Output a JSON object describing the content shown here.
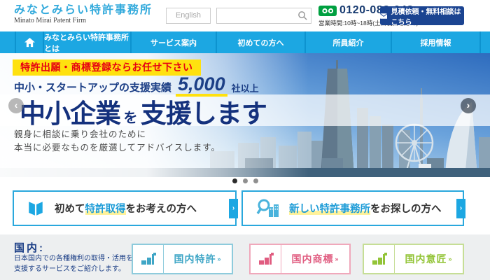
{
  "header": {
    "logo_title": "みなとみらい特許事務所",
    "logo_subtitle": "Minato Mirai Patent Firm",
    "english_button": "English",
    "search_value": "",
    "phone": "0120-088-048",
    "hours": "営業時間:10時~18時(土日祝日を除く)",
    "cta_label": "見積依頼・無料相談はこちら"
  },
  "nav": {
    "items": [
      {
        "label": "みなとみらい特許事務所とは"
      },
      {
        "label": "サービス案内"
      },
      {
        "label": "初めての方へ"
      },
      {
        "label": "所員紹介"
      },
      {
        "label": "採用情報"
      }
    ]
  },
  "hero": {
    "ribbon": "特許出願・商標登録ならお任せ下さい",
    "stat_prefix": "中小・スタートアップの支援実績",
    "stat_number": "5,000",
    "stat_suffix": "社以上",
    "title_part1": "中小企業",
    "title_particle": "を",
    "title_part2": "支援します",
    "subtext_line1": "親身に相談に乗り会社のために",
    "subtext_line2": "本当に必要なものを厳選してアドバイスします。",
    "prev_glyph": "‹",
    "next_glyph": "›"
  },
  "carousel": {
    "dot_count": 3,
    "active_index": 0
  },
  "links": [
    {
      "pre": "初めて",
      "highlight": "特許取得",
      "post": "をお考えの方へ",
      "icon": "book-icon",
      "tab_glyph": "›"
    },
    {
      "pre": "",
      "highlight": "新しい特許事務所",
      "post": "をお探しの方へ",
      "icon": "search-buildings-icon",
      "tab_glyph": "›"
    }
  ],
  "domestic": {
    "heading": "国内:",
    "desc_line1": "日本国内での各種権利の取得・活用を",
    "desc_line2": "支援するサービスをご紹介します。",
    "buttons": [
      {
        "label": "国内特許",
        "arrow": "»",
        "color": "#3fa6c6"
      },
      {
        "label": "国内商標",
        "arrow": "»",
        "color": "#e05c80"
      },
      {
        "label": "国内意匠",
        "arrow": "»",
        "color": "#93c437"
      }
    ]
  },
  "colors": {
    "accent_cyan": "#1ca7e2",
    "navy": "#14317d",
    "cta_navy": "#1b4491",
    "ribbon_yellow": "#ffe10f",
    "ribbon_red": "#e60012",
    "freedial_green": "#00a040",
    "section_gray": "#edeff0"
  }
}
